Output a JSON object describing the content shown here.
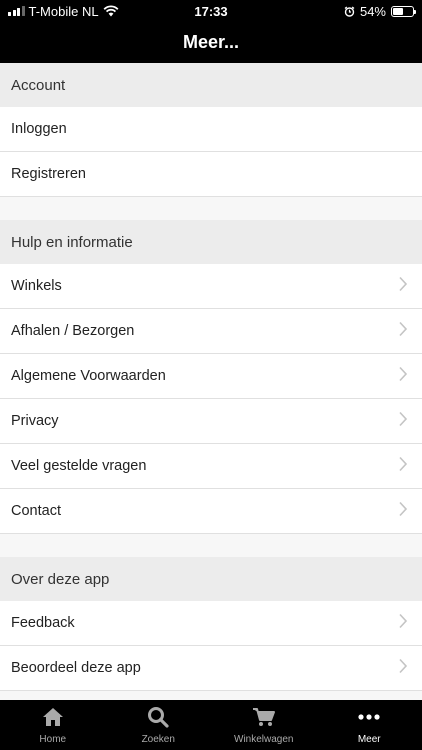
{
  "status_bar": {
    "carrier": "T-Mobile NL",
    "time": "17:33",
    "battery_percent": "54%",
    "battery_level": 0.54
  },
  "nav": {
    "title": "Meer..."
  },
  "sections": [
    {
      "title": "Account",
      "items": [
        {
          "label": "Inloggen",
          "chevron": false
        },
        {
          "label": "Registreren",
          "chevron": false
        }
      ]
    },
    {
      "title": "Hulp en informatie",
      "items": [
        {
          "label": "Winkels",
          "chevron": true
        },
        {
          "label": "Afhalen / Bezorgen",
          "chevron": true
        },
        {
          "label": "Algemene Voorwaarden",
          "chevron": true
        },
        {
          "label": "Privacy",
          "chevron": true
        },
        {
          "label": "Veel gestelde vragen",
          "chevron": true
        },
        {
          "label": "Contact",
          "chevron": true
        }
      ]
    },
    {
      "title": "Over deze app",
      "items": [
        {
          "label": "Feedback",
          "chevron": true
        },
        {
          "label": "Beoordeel deze app",
          "chevron": true
        }
      ]
    }
  ],
  "tabs": [
    {
      "label": "Home",
      "icon": "home-icon",
      "active": false
    },
    {
      "label": "Zoeken",
      "icon": "search-icon",
      "active": false
    },
    {
      "label": "Winkelwagen",
      "icon": "cart-icon",
      "active": false
    },
    {
      "label": "Meer",
      "icon": "more-icon",
      "active": true
    }
  ],
  "colors": {
    "bar": "#000000",
    "section_bg": "#ececec",
    "active_tab": "#ffffff",
    "inactive_tab": "#aaaaaa"
  }
}
